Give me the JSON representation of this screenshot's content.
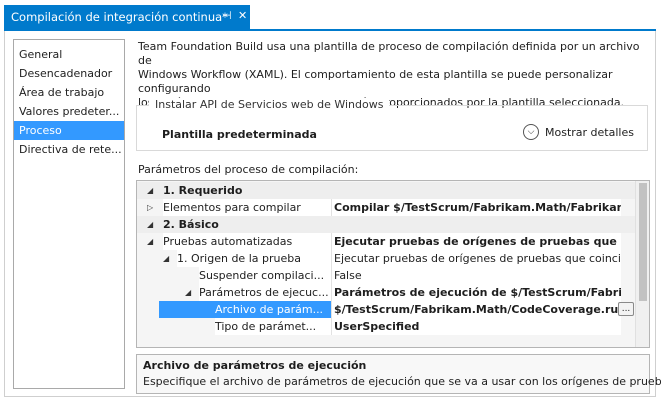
{
  "tab": {
    "title": "Compilación de integración continua*",
    "pin_glyph": "⊣",
    "close_glyph": "✕"
  },
  "nav": {
    "items": [
      {
        "label": "General"
      },
      {
        "label": "Desencadenador"
      },
      {
        "label": "Área de trabajo"
      },
      {
        "label": "Valores predeter..."
      },
      {
        "label": "Proceso"
      },
      {
        "label": "Directiva de rete..."
      }
    ],
    "selected_index": 4
  },
  "description": {
    "line1": "Team Foundation Build usa una plantilla de proceso de compilación definida por un archivo de",
    "line2": "Windows Workflow (XAML). El comportamiento de esta plantilla se puede personalizar configurando",
    "line3": "los parámetros del proceso de compilación proporcionados por la plantilla seleccionada."
  },
  "install": {
    "title": "Instalar API de Servicios web de Windows",
    "template_label": "Plantilla predeterminada",
    "details_label": "Mostrar detalles"
  },
  "params_label": "Parámetros del proceso de compilación:",
  "grid": {
    "rows": [
      {
        "type": "cat",
        "label": "1. Requerido"
      },
      {
        "type": "prop",
        "label": "Elementos para compilar",
        "value": "Compilar $/TestScrum/Fabrikam.Math/Fabrikam.Ma..."
      },
      {
        "type": "cat",
        "label": "2. Básico"
      },
      {
        "type": "prop",
        "label": "Pruebas automatizadas",
        "value": "Ejecutar pruebas de orígenes de pruebas que coinci..."
      },
      {
        "type": "prop",
        "label": "1. Origen de la prueba",
        "value": "Ejecutar pruebas de orígenes de pruebas que coincidan..."
      },
      {
        "type": "prop",
        "label": "Suspender compilaci...",
        "value": "False"
      },
      {
        "type": "prop",
        "label": "Parámetros de ejecuc...",
        "value": "Parámetros de ejecución de $/TestScrum/Fabrikam..."
      },
      {
        "type": "prop",
        "label": "Archivo de parám...",
        "value": "$/TestScrum/Fabrikam.Math/CodeCoverage.run..."
      },
      {
        "type": "prop",
        "label": "Tipo de parámet...",
        "value": "UserSpecified"
      }
    ],
    "ellipsis_label": "..."
  },
  "info": {
    "title": "Archivo de parámetros de ejecución",
    "text": "Especifique el archivo de parámetros de ejecución que se va a usar con los orígenes de pruebas."
  }
}
